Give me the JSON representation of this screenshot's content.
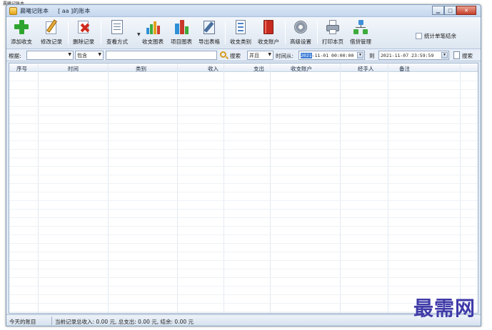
{
  "window": {
    "app_name": "晨曦记账本",
    "book_label": "[ aa ]的账本"
  },
  "toolbar": {
    "buttons": [
      {
        "label": "添加收支",
        "icon": "add-plus-icon"
      },
      {
        "label": "修改记录",
        "icon": "edit-pencil-icon"
      },
      {
        "label": "删除记录",
        "icon": "delete-x-icon"
      },
      {
        "label": "查看方式",
        "icon": "view-list-icon"
      },
      {
        "label": "收支图表",
        "icon": "bar-chart-icon"
      },
      {
        "label": "项目图表",
        "icon": "pie-chart-icon"
      },
      {
        "label": "导出表格",
        "icon": "export-icon"
      },
      {
        "label": "收支类别",
        "icon": "category-icon"
      },
      {
        "label": "收支账户",
        "icon": "account-book-icon"
      },
      {
        "label": "高级设置",
        "icon": "gear-icon"
      },
      {
        "label": "打印本页",
        "icon": "printer-icon"
      },
      {
        "label": "借贷管理",
        "icon": "network-icon"
      }
    ],
    "stat_checkbox_label": "统计单笔结余"
  },
  "filter": {
    "basis_label": "根据:",
    "basis_value": "",
    "match_value": "包含",
    "search_value": "",
    "search_label": "搜索",
    "logic_value": "并且",
    "time_from_label": "时间从:",
    "date_from_highlight": "2021",
    "date_from_rest": "-11-01 00:00:00",
    "to_label": "到",
    "date_to": "2021-11-07 23:59:59",
    "search_button_label": "搜索"
  },
  "grid": {
    "columns": [
      "序号",
      "时间",
      "类别",
      "收入",
      "支出",
      "收支账户",
      "经手人",
      "备注"
    ],
    "rows": []
  },
  "status": {
    "today_label": "今天的账目",
    "summary": "当前记录总收入: 0.00 元, 总支出: 0.00 元, 结余: 0.00 元"
  },
  "watermark": "最需网",
  "colors": {
    "accent": "#3a7bd5",
    "watermark": "#3f3aa8",
    "close_button": "#c6402b"
  }
}
